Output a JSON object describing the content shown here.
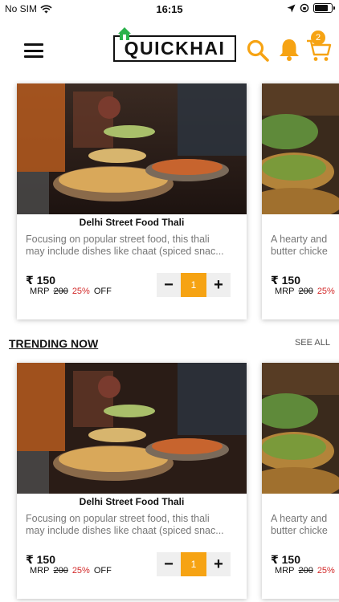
{
  "status_bar": {
    "carrier": "No SIM",
    "time": "16:15"
  },
  "header": {
    "logo_text": "QUICKHAI",
    "cart_count": "2"
  },
  "colors": {
    "accent": "#f6a313",
    "discount": "#d32b2b"
  },
  "top_row": {
    "cards": [
      {
        "title": "Delhi Street Food Thali",
        "desc_line1": "Focusing on popular street food, this thali",
        "desc_line2": "may include dishes like chaat (spiced snac...",
        "price": "₹ 150",
        "mrp_label": "MRP",
        "mrp_value": "200",
        "discount": "25%",
        "off_label": "OFF",
        "qty": "1"
      },
      {
        "title": "",
        "desc_line1": "A hearty and",
        "desc_line2": "butter chicke",
        "price": "₹ 150",
        "mrp_label": "MRP",
        "mrp_value": "200",
        "discount": "25%",
        "off_label": "",
        "qty": ""
      }
    ]
  },
  "trending": {
    "title": "TRENDING NOW",
    "see_all": "SEE ALL",
    "cards": [
      {
        "title": "Delhi Street Food Thali",
        "desc_line1": "Focusing on popular street food, this thali",
        "desc_line2": "may include dishes like chaat (spiced snac...",
        "price": "₹ 150",
        "mrp_label": "MRP",
        "mrp_value": "200",
        "discount": "25%",
        "off_label": "OFF",
        "qty": "1"
      },
      {
        "title": "",
        "desc_line1": "A hearty and",
        "desc_line2": "butter chicke",
        "price": "₹ 150",
        "mrp_label": "MRP",
        "mrp_value": "200",
        "discount": "25%",
        "off_label": "",
        "qty": ""
      }
    ]
  }
}
